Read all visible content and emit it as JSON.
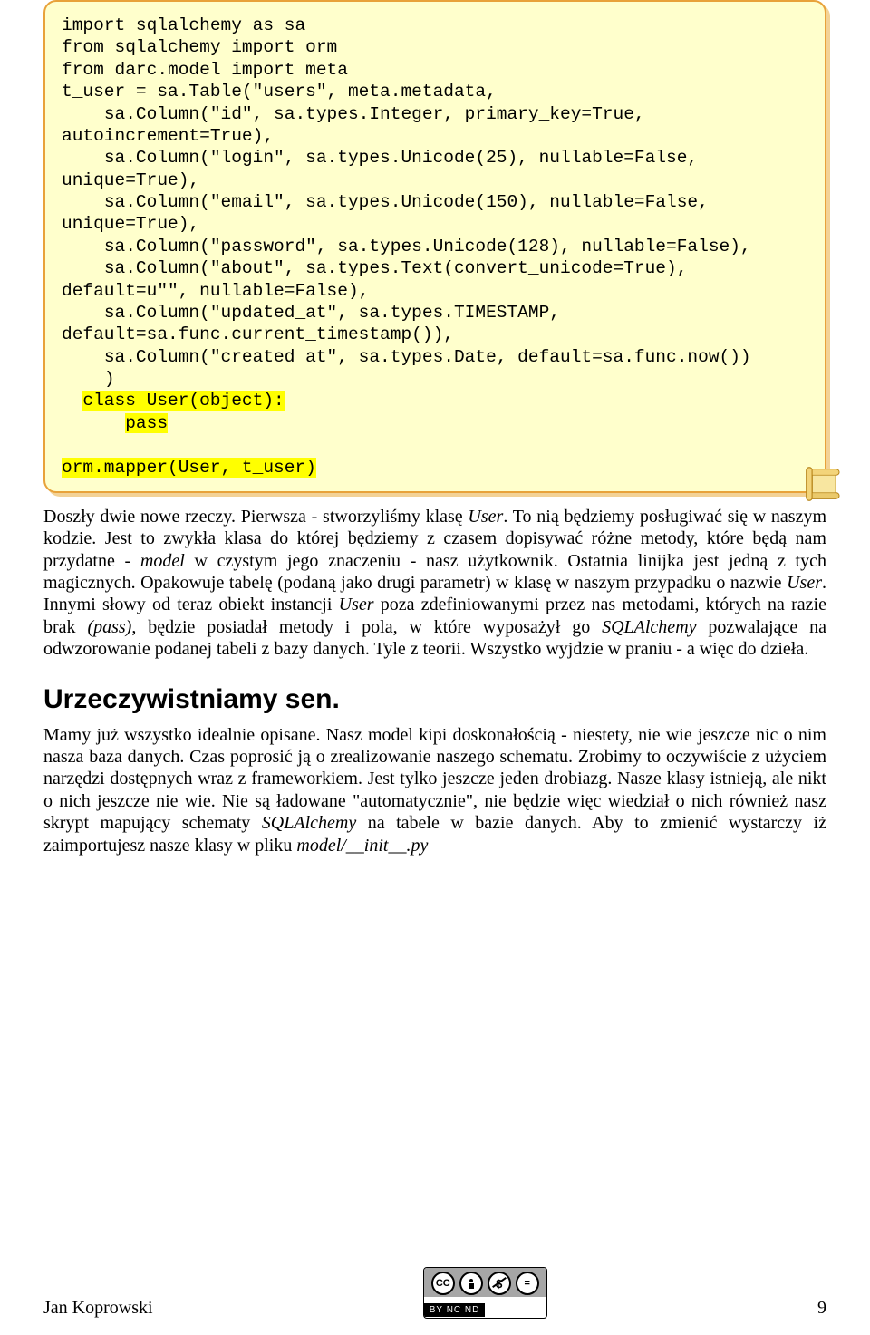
{
  "code": {
    "lines": [
      "import sqlalchemy as sa",
      "from sqlalchemy import orm",
      "",
      "from darc.model import meta",
      "",
      "t_user = sa.Table(\"users\", meta.metadata,",
      "    sa.Column(\"id\", sa.types.Integer, primary_key=True, autoincrement=True),",
      "    sa.Column(\"login\", sa.types.Unicode(25), nullable=False, unique=True),",
      "    sa.Column(\"email\", sa.types.Unicode(150), nullable=False, unique=True),",
      "    sa.Column(\"password\", sa.types.Unicode(128), nullable=False),",
      "    sa.Column(\"about\", sa.types.Text(convert_unicode=True), default=u\"\", nullable=False),",
      "    sa.Column(\"updated_at\", sa.types.TIMESTAMP, default=sa.func.current_timestamp()),",
      "    sa.Column(\"created_at\", sa.types.Date, default=sa.func.now())",
      "    )",
      ""
    ],
    "hl1a": "class User(object):",
    "hl1b": "pass",
    "hl2": "orm.mapper(User, t_user)"
  },
  "para1_parts": [
    "Doszły dwie nowe rzeczy. Pierwsza - stworzyliśmy klasę ",
    "User",
    ". To nią będziemy posługiwać się w naszym kodzie. Jest to zwykła klasa do której będziemy z czasem dopisywać różne metody, które będą nam przydatne - ",
    "model",
    " w czystym jego znaczeniu - nasz użytkownik. Ostatnia linijka jest jedną z tych magicznych. Opakowuje tabelę (podaną jako drugi parametr) w klasę w naszym przypadku o nazwie ",
    "User",
    ". Innymi słowy od teraz obiekt instancji ",
    "User",
    " poza zdefiniowanymi przez nas metodami, których na razie brak ",
    "(pass)",
    ", będzie posiadał metody i pola, w które wyposażył go ",
    "SQLAlchemy",
    " pozwalające na odwzorowanie podanej tabeli z bazy danych. Tyle z teorii. Wszystko wyjdzie w praniu - a więc do dzieła."
  ],
  "section_heading": "Urzeczywistniamy sen.",
  "para2_parts": [
    "Mamy już wszystko idealnie opisane. Nasz model kipi doskonałością - niestety, nie wie jeszcze nic o nim nasza baza danych. Czas poprosić ją o zrealizowanie naszego schematu. Zrobimy to oczywiście z użyciem narzędzi dostępnych wraz z frameworkiem. Jest tylko jeszcze jeden drobiazg. Nasze klasy istnieją, ale nikt o nich jeszcze nie wie. Nie są ładowane \"automatycznie\", nie będzie więc wiedział o nich również nasz skrypt mapujący schematy ",
    "SQLAlchemy",
    " na tabele w bazie danych. Aby to zmienić wystarczy iż zaimportujesz nasze klasy w pliku ",
    "model/__init__.py"
  ],
  "footer": {
    "author": "Jan Koprowski",
    "page": "9",
    "cc_text": "BY   NC   ND",
    "cc_icons": [
      "CC",
      "•",
      "$",
      "="
    ]
  }
}
